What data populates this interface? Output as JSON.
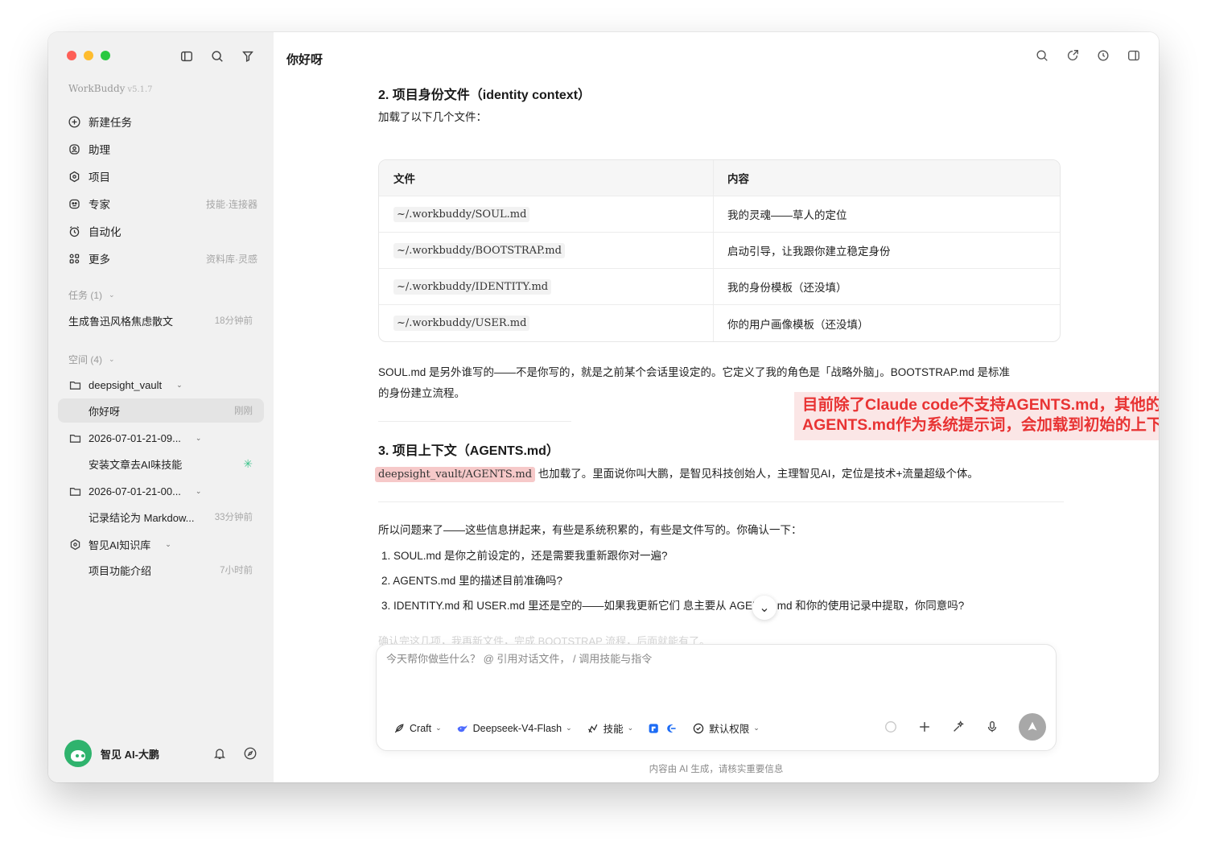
{
  "app": {
    "name": "WorkBuddy",
    "version": "v5.1.7"
  },
  "sidebar": {
    "nav": [
      {
        "label": "新建任务",
        "hint": ""
      },
      {
        "label": "助理",
        "hint": ""
      },
      {
        "label": "项目",
        "hint": ""
      },
      {
        "label": "专家",
        "hint": "技能·连接器"
      },
      {
        "label": "自动化",
        "hint": ""
      },
      {
        "label": "更多",
        "hint": "资料库·灵感"
      }
    ],
    "tasks_header": "任务 (1)",
    "task": {
      "title": "生成鲁迅风格焦虑散文",
      "time": "18分钟前"
    },
    "spaces_header": "空间 (4)",
    "spaces": [
      {
        "name": "deepsight_vault",
        "child": "你好呀",
        "child_time": "刚刚"
      },
      {
        "name": "2026-07-01-21-09...",
        "child": "安装文章去AI味技能",
        "child_time": ""
      },
      {
        "name": "2026-07-01-21-00...",
        "child": "记录结论为 Markdow...",
        "child_time": "33分钟前"
      },
      {
        "name": "智见AI知识库",
        "child": "项目功能介绍",
        "child_time": "7小时前"
      }
    ],
    "user": "智见 AI-大鹏"
  },
  "main": {
    "title": "你好呀",
    "section2_title": "2. 项目身份文件（identity context）",
    "section2_intro": "加载了以下几个文件：",
    "table": {
      "headers": [
        "文件",
        "内容"
      ],
      "rows": [
        {
          "file": "~/.workbuddy/SOUL.md",
          "content": "我的灵魂——草人的定位"
        },
        {
          "file": "~/.workbuddy/BOOTSTRAP.md",
          "content": "启动引导，让我跟你建立稳定身份"
        },
        {
          "file": "~/.workbuddy/IDENTITY.md",
          "content": "我的身份模板（还没填）"
        },
        {
          "file": "~/.workbuddy/USER.md",
          "content": "你的用户画像模板（还没填）"
        }
      ]
    },
    "soul_para_line1": "SOUL.md 是另外谁写的——不是你写的，就是之前某个会话里设定的。它定义了我的角色是「战略外脑」。BOOTSTRAP.md 是标准",
    "soul_para_line2": "的身份建立流程。",
    "callout": "目前除了Claude code不支持AGENTS.md，其他的任何的Agent都支持AGENTS.md作为系统提示词，会加载到初始的上下文中。",
    "section3_title": "3. 项目上下文（AGENTS.md）",
    "agents_code": "deepsight_vault/AGENTS.md",
    "agents_text": " 也加载了。里面说你叫大鹏，是智见科技创始人，主理智见AI，定位是技术+流量超级个体。",
    "question_intro": "所以问题来了——这些信息拼起来，有些是系统积累的，有些是文件写的。你确认一下：",
    "questions": [
      "1. SOUL.md 是你之前设定的，还是需要我重新跟你对一遍?",
      "2. AGENTS.md 里的描述目前准确吗?",
      "3. IDENTITY.md 和 USER.md 里还是空的——如果我更新它们          息主要从 AGENTS.md 和你的使用记录中提取，你同意吗?"
    ],
    "faded_line": "确认完这几项，我再新文件，完成 BOOTSTRAP 流程，后面就能有了。",
    "composer": {
      "placeholder": "今天帮你做些什么？ @ 引用对话文件， / 调用技能与指令",
      "mode": "Craft",
      "model": "Deepseek-V4-Flash",
      "skills": "技能",
      "permission": "默认权限"
    },
    "disclaimer": "内容由 AI 生成，请核实重要信息"
  }
}
